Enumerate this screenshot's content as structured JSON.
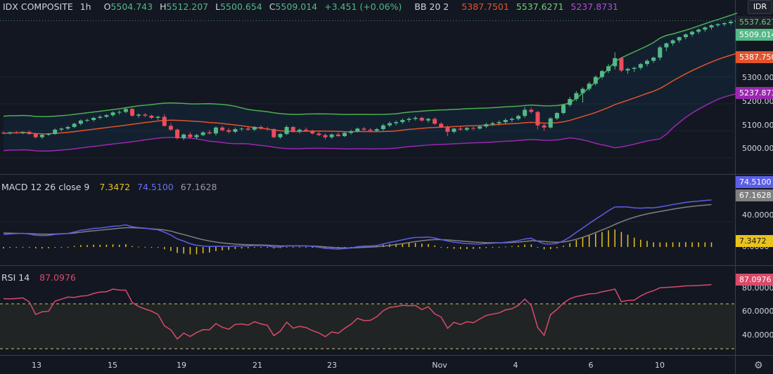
{
  "legend": {
    "symbol": "IDX COMPOSITE",
    "interval": "1h",
    "open_label": "O",
    "open": "5504.743",
    "high_label": "H",
    "high": "5512.207",
    "low_label": "L",
    "low": "5500.654",
    "close_label": "C",
    "close": "5509.014",
    "change": "+3.451 (+0.06%)",
    "bb_label": "BB 20 2",
    "bb_basis": "5387.7501",
    "bb_upper": "5537.6271",
    "bb_lower": "5237.8731",
    "macd_label": "MACD 12 26 close 9",
    "macd_hist": "7.3472",
    "macd_line": "74.5100",
    "macd_signal": "67.1628",
    "rsi_label": "RSI 14",
    "rsi_value": "87.0976"
  },
  "currency": "IDR",
  "price_boxes": {
    "upper": "5537.6271",
    "close": "5509.014",
    "basis": "5387.7501",
    "lower": "5237.8731",
    "macd_line": "74.5100",
    "macd_signal": "67.1628",
    "macd_hist": "7.3472",
    "rsi": "87.0976"
  },
  "price_axis": [
    "5300.000",
    "5200.000",
    "5100.000",
    "5000.000"
  ],
  "macd_axis": [
    "40.0000",
    "0.0000"
  ],
  "rsi_axis": [
    "80.0000",
    "60.0000",
    "40.0000"
  ],
  "x_axis": [
    "13",
    "15",
    "19",
    "21",
    "23",
    "Nov",
    "4",
    "6",
    "10"
  ],
  "colors": {
    "up": "#53b987",
    "down": "#eb4d5c",
    "bb_upper": "#4caf50",
    "bb_basis": "#e2542d",
    "bb_lower": "#9c27b0",
    "macd": "#5b5fe6",
    "signal": "#808080",
    "hist": "#e8c31c",
    "rsi": "#d94a6a"
  },
  "chart_data": [
    {
      "type": "candlestick",
      "title": "IDX COMPOSITE",
      "ylim": [
        4960,
        5560
      ],
      "x_ticks": [
        "13",
        "15",
        "19",
        "21",
        "23",
        "Nov",
        "4",
        "6",
        "10"
      ],
      "candles": [
        [
          5093,
          5098,
          5088,
          5090
        ],
        [
          5090,
          5096,
          5086,
          5094
        ],
        [
          5094,
          5099,
          5089,
          5092
        ],
        [
          5092,
          5097,
          5087,
          5096
        ],
        [
          5096,
          5100,
          5085,
          5088
        ],
        [
          5088,
          5093,
          5072,
          5076
        ],
        [
          5076,
          5088,
          5070,
          5085
        ],
        [
          5085,
          5092,
          5081,
          5088
        ],
        [
          5088,
          5108,
          5085,
          5104
        ],
        [
          5104,
          5112,
          5098,
          5108
        ],
        [
          5108,
          5118,
          5103,
          5114
        ],
        [
          5114,
          5130,
          5110,
          5126
        ],
        [
          5126,
          5142,
          5120,
          5138
        ],
        [
          5138,
          5145,
          5132,
          5140
        ],
        [
          5140,
          5152,
          5134,
          5148
        ],
        [
          5148,
          5158,
          5143,
          5152
        ],
        [
          5152,
          5162,
          5148,
          5158
        ],
        [
          5158,
          5172,
          5152,
          5168
        ],
        [
          5168,
          5176,
          5160,
          5170
        ],
        [
          5170,
          5185,
          5165,
          5181
        ],
        [
          5181,
          5185,
          5152,
          5156
        ],
        [
          5156,
          5164,
          5148,
          5160
        ],
        [
          5160,
          5166,
          5150,
          5156
        ],
        [
          5156,
          5160,
          5144,
          5148
        ],
        [
          5148,
          5156,
          5140,
          5152
        ],
        [
          5152,
          5162,
          5115,
          5118
        ],
        [
          5118,
          5128,
          5100,
          5104
        ],
        [
          5104,
          5108,
          5068,
          5072
        ],
        [
          5072,
          5090,
          5065,
          5086
        ],
        [
          5086,
          5095,
          5072,
          5076
        ],
        [
          5076,
          5088,
          5070,
          5084
        ],
        [
          5084,
          5098,
          5080,
          5094
        ],
        [
          5094,
          5102,
          5086,
          5090
        ],
        [
          5090,
          5116,
          5082,
          5112
        ],
        [
          5112,
          5118,
          5098,
          5102
        ],
        [
          5102,
          5110,
          5090,
          5096
        ],
        [
          5096,
          5112,
          5091,
          5106
        ],
        [
          5106,
          5112,
          5100,
          5108
        ],
        [
          5108,
          5114,
          5100,
          5104
        ],
        [
          5104,
          5118,
          5099,
          5114
        ],
        [
          5114,
          5120,
          5104,
          5108
        ],
        [
          5108,
          5115,
          5100,
          5106
        ],
        [
          5106,
          5110,
          5072,
          5076
        ],
        [
          5076,
          5092,
          5070,
          5088
        ],
        [
          5088,
          5120,
          5084,
          5114
        ],
        [
          5114,
          5118,
          5094,
          5098
        ],
        [
          5098,
          5108,
          5090,
          5104
        ],
        [
          5104,
          5112,
          5098,
          5100
        ],
        [
          5100,
          5104,
          5086,
          5090
        ],
        [
          5090,
          5096,
          5080,
          5084
        ],
        [
          5084,
          5090,
          5068,
          5076
        ],
        [
          5076,
          5090,
          5070,
          5086
        ],
        [
          5086,
          5094,
          5078,
          5080
        ],
        [
          5080,
          5096,
          5076,
          5092
        ],
        [
          5092,
          5104,
          5086,
          5098
        ],
        [
          5098,
          5112,
          5094,
          5108
        ],
        [
          5108,
          5114,
          5098,
          5104
        ],
        [
          5104,
          5110,
          5096,
          5100
        ],
        [
          5100,
          5110,
          5096,
          5106
        ],
        [
          5106,
          5126,
          5100,
          5120
        ],
        [
          5120,
          5134,
          5114,
          5128
        ],
        [
          5128,
          5138,
          5120,
          5132
        ],
        [
          5132,
          5146,
          5126,
          5140
        ],
        [
          5140,
          5150,
          5132,
          5144
        ],
        [
          5144,
          5154,
          5138,
          5148
        ],
        [
          5148,
          5152,
          5134,
          5138
        ],
        [
          5138,
          5148,
          5130,
          5144
        ],
        [
          5144,
          5150,
          5122,
          5126
        ],
        [
          5126,
          5132,
          5110,
          5114
        ],
        [
          5114,
          5120,
          5080,
          5096
        ],
        [
          5096,
          5110,
          5090,
          5108
        ],
        [
          5108,
          5118,
          5100,
          5104
        ],
        [
          5104,
          5114,
          5098,
          5110
        ],
        [
          5110,
          5116,
          5102,
          5108
        ],
        [
          5108,
          5120,
          5104,
          5116
        ],
        [
          5116,
          5130,
          5110,
          5124
        ],
        [
          5124,
          5134,
          5118,
          5128
        ],
        [
          5128,
          5138,
          5120,
          5132
        ],
        [
          5132,
          5146,
          5126,
          5140
        ],
        [
          5140,
          5150,
          5132,
          5144
        ],
        [
          5144,
          5160,
          5138,
          5155
        ],
        [
          5155,
          5188,
          5148,
          5178
        ],
        [
          5178,
          5186,
          5164,
          5170
        ],
        [
          5170,
          5174,
          5105,
          5120
        ],
        [
          5120,
          5128,
          5100,
          5112
        ],
        [
          5112,
          5150,
          5108,
          5146
        ],
        [
          5146,
          5170,
          5140,
          5166
        ],
        [
          5166,
          5200,
          5160,
          5196
        ],
        [
          5196,
          5226,
          5190,
          5218
        ],
        [
          5218,
          5248,
          5210,
          5240
        ],
        [
          5240,
          5262,
          5205,
          5256
        ],
        [
          5256,
          5282,
          5248,
          5275
        ],
        [
          5275,
          5306,
          5268,
          5300
        ],
        [
          5300,
          5326,
          5292,
          5322
        ],
        [
          5322,
          5348,
          5314,
          5340
        ],
        [
          5340,
          5392,
          5328,
          5370
        ],
        [
          5370,
          5374,
          5318,
          5324
        ],
        [
          5324,
          5334,
          5312,
          5330
        ],
        [
          5330,
          5338,
          5318,
          5334
        ],
        [
          5334,
          5352,
          5326,
          5348
        ],
        [
          5348,
          5366,
          5340,
          5360
        ],
        [
          5360,
          5376,
          5352,
          5372
        ],
        [
          5372,
          5416,
          5362,
          5410
        ],
        [
          5410,
          5428,
          5396,
          5425
        ],
        [
          5425,
          5440,
          5416,
          5436
        ],
        [
          5436,
          5450,
          5428,
          5448
        ],
        [
          5448,
          5462,
          5440,
          5458
        ],
        [
          5458,
          5472,
          5450,
          5468
        ],
        [
          5468,
          5480,
          5460,
          5476
        ],
        [
          5476,
          5488,
          5468,
          5484
        ],
        [
          5484,
          5496,
          5476,
          5492
        ],
        [
          5492,
          5500,
          5486,
          5496
        ],
        [
          5496,
          5504,
          5488,
          5500
        ],
        [
          5500,
          5512,
          5494,
          5505
        ],
        [
          5504.743,
          5512.207,
          5500.654,
          5509.014
        ]
      ],
      "bollinger": {
        "period": 20,
        "mult": 2,
        "upper_last": 5537.6271,
        "basis_last": 5387.7501,
        "lower_last": 5237.8731
      }
    },
    {
      "type": "macd",
      "title": "MACD 12 26 close 9",
      "ylim": [
        -20,
        100
      ],
      "macd": [
        19.8,
        20.5,
        21.3,
        21.6,
        20.5,
        18.6,
        18.0,
        18.4,
        20.0,
        20.6,
        21.6,
        23.7,
        26.4,
        27.6,
        29.4,
        30.0,
        31.4,
        32.8,
        33.4,
        35.1,
        32.1,
        30.7,
        29.9,
        28.3,
        27.3,
        23.4,
        19.0,
        12.8,
        9.3,
        5.3,
        2.6,
        1.6,
        0.8,
        1.2,
        1.1,
        0.9,
        1.4,
        1.7,
        1.6,
        2.4,
        2.2,
        1.8,
        -0.1,
        -0.1,
        1.9,
        1.8,
        1.9,
        1.8,
        0.9,
        -0.3,
        -2.2,
        -2.8,
        -3.3,
        -2.5,
        -1.5,
        0.4,
        1.4,
        1.7,
        2.4,
        4.9,
        7.2,
        9.2,
        11.4,
        13.6,
        15.1,
        15.2,
        15.8,
        14.2,
        11.8,
        9.4,
        7.6,
        6.4,
        5.4,
        4.8,
        4.7,
        5.4,
        6.1,
        6.5,
        7.5,
        8.6,
        10.2,
        12.7,
        13.8,
        8.9,
        5.1,
        4.6,
        5.7,
        9.9,
        15.7,
        23.2,
        30.2,
        37.1,
        44.2,
        50.6,
        57.5,
        63.4,
        63.6,
        63.3,
        61.9,
        61.5,
        62.1,
        61.9,
        63.5,
        65.3,
        67.3,
        68.9,
        70.7,
        71.8,
        72.7,
        73.7,
        74.5
      ],
      "signal": [
        22.1,
        21.9,
        21.6,
        21.4,
        21.3,
        20.7,
        20.4,
        20.3,
        20.6,
        21.0,
        21.4,
        22.1,
        23.4,
        24.6,
        25.7,
        26.6,
        27.7,
        28.6,
        29.7,
        30.5,
        30.6,
        30.1,
        29.6,
        28.8,
        28.0,
        26.9,
        25.2,
        22.2,
        19.8,
        16.9,
        14.0,
        11.6,
        9.5,
        7.8,
        6.4,
        5.4,
        4.6,
        4.0,
        3.6,
        3.4,
        3.2,
        2.9,
        2.2,
        1.6,
        1.7,
        1.6,
        1.6,
        1.6,
        1.4,
        1.0,
        0.2,
        -0.5,
        -1.1,
        -1.4,
        -1.5,
        -1.1,
        -0.6,
        -0.1,
        0.4,
        1.3,
        2.5,
        3.8,
        5.3,
        7.0,
        8.6,
        9.9,
        11.1,
        11.7,
        11.7,
        11.2,
        10.4,
        9.6,
        8.7,
        7.9,
        7.3,
        6.9,
        6.8,
        6.7,
        6.8,
        7.2,
        7.8,
        8.8,
        9.8,
        9.6,
        8.7,
        7.9,
        7.5,
        7.9,
        9.7,
        12.3,
        15.3,
        18.9,
        22.8,
        27.0,
        31.1,
        35.7,
        39.9,
        43.8,
        47.1,
        50.0,
        52.4,
        54.4,
        56.3,
        58.1,
        59.9,
        61.5,
        63.0,
        64.3,
        65.4,
        66.3,
        67.2
      ],
      "histogram_last": 7.3472,
      "macd_last": 74.51,
      "signal_last": 67.1628
    },
    {
      "type": "line",
      "title": "RSI 14",
      "ylim": [
        25,
        100
      ],
      "levels": [
        70,
        30
      ],
      "values": [
        74.6,
        74.4,
        74.8,
        75.3,
        71.7,
        60.5,
        62.9,
        63.4,
        72.4,
        74.2,
        76.0,
        75.7,
        76.9,
        77.3,
        79.2,
        80.5,
        80.8,
        83.1,
        82.3,
        82.2,
        71.2,
        67.5,
        65.4,
        63.5,
        60.6,
        50.4,
        46.8,
        38.7,
        43.9,
        40.9,
        44.4,
        47.0,
        46.9,
        52.4,
        49.1,
        47.4,
        51.6,
        52.1,
        51.0,
        54.1,
        52.1,
        50.9,
        41.7,
        45.6,
        53.7,
        48.3,
        49.9,
        48.9,
        46.1,
        44.1,
        40.8,
        45.0,
        43.8,
        48.1,
        51.8,
        57.1,
        55.1,
        55.3,
        58.5,
        63.9,
        66.8,
        67.5,
        68.6,
        68.3,
        68.5,
        64.9,
        67.4,
        61.1,
        58.2,
        48.2,
        53.6,
        51.5,
        54.1,
        53.2,
        56.5,
        59.6,
        60.9,
        61.9,
        64.6,
        65.6,
        68.7,
        74.3,
        68.6,
        49.0,
        42.0,
        60.4,
        65.0,
        70.7,
        74.5,
        76.5,
        77.6,
        78.9,
        79.1,
        80.8,
        81.8,
        83.1,
        71.9,
        73.0,
        73.3,
        77.0,
        79.9,
        81.7,
        84.3,
        84.6,
        85.0,
        85.4,
        86.0,
        86.1,
        86.4,
        86.7,
        87.0976
      ]
    }
  ]
}
